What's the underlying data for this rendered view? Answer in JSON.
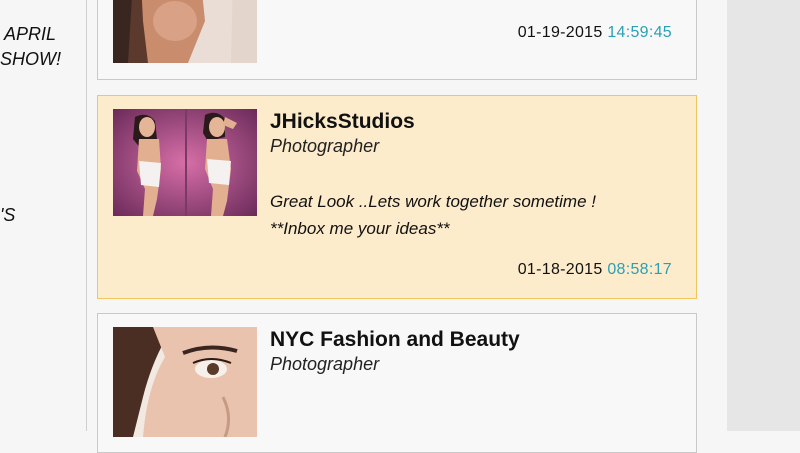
{
  "left_snippets": [
    "APRIL",
    "SHOW!",
    "'S"
  ],
  "cards": [
    {
      "name": "",
      "role": "",
      "date": "01-19-2015",
      "time": "14:59:45"
    },
    {
      "name": "JHicksStudios",
      "role": "Photographer",
      "message_line1": "Great Look ..Lets work together sometime !",
      "message_line2": "**Inbox me your ideas**",
      "date": "01-18-2015",
      "time": "08:58:17"
    },
    {
      "name": "NYC Fashion and Beauty",
      "role": "Photographer"
    }
  ],
  "colors": {
    "highlight_bg": "#fdeccc",
    "highlight_border": "#f0c75e",
    "time_accent": "#2aa0b5"
  }
}
